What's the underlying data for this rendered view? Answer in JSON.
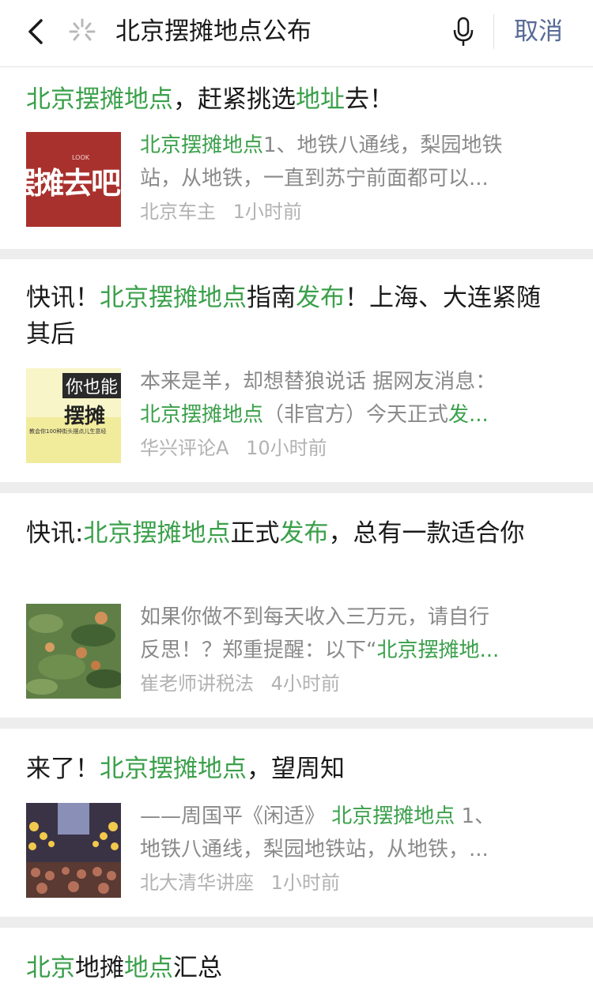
{
  "search": {
    "query": "北京摆摊地点公布",
    "cancel_label": "取消"
  },
  "results": [
    {
      "title": [
        {
          "text": "北京摆摊地点",
          "hl": true
        },
        {
          "text": "，赶紧挑选",
          "hl": false
        },
        {
          "text": "地址",
          "hl": true
        },
        {
          "text": "去！",
          "hl": false
        }
      ],
      "snippet_lines": [
        [
          {
            "text": "北京摆摊地点",
            "hl": true
          },
          {
            "text": "1、地铁八通线，梨园地铁",
            "hl": false
          }
        ],
        [
          {
            "text": "站，从地铁，一直到苏宁前面都可以...",
            "hl": false
          }
        ]
      ],
      "source": "北京车主",
      "time": "1小时前",
      "thumb_text": "摆摊去吧",
      "thumb_small_text": "LOOK"
    },
    {
      "title": [
        {
          "text": "快讯！",
          "hl": false
        },
        {
          "text": "北京摆摊地点",
          "hl": true
        },
        {
          "text": "指南",
          "hl": false
        },
        {
          "text": "发布",
          "hl": true
        },
        {
          "text": "！上海、大连紧随其后",
          "hl": false
        }
      ],
      "snippet_lines": [
        [
          {
            "text": "本来是羊，却想替狼说话 据网友消息：",
            "hl": false
          }
        ],
        [
          {
            "text": "北京摆摊地点",
            "hl": true
          },
          {
            "text": "（非官方）今天正式",
            "hl": false
          },
          {
            "text": "发...",
            "hl": true
          }
        ]
      ],
      "source": "华兴评论A",
      "time": "10小时前",
      "thumb_text_top": "你也能",
      "thumb_text_main": "摆摊",
      "thumb_small_text": "教会你100种街头摆点儿生意经"
    },
    {
      "title": [
        {
          "text": "快讯:",
          "hl": false
        },
        {
          "text": "北京摆摊地点",
          "hl": true
        },
        {
          "text": "正式",
          "hl": false
        },
        {
          "text": "发布",
          "hl": true
        },
        {
          "text": "，总有一款适合你",
          "hl": false
        }
      ],
      "snippet_lines": [
        [
          {
            "text": "如果你做不到每天收入三万元，请自行",
            "hl": false
          }
        ],
        [
          {
            "text": "反思！？郑重提醒：以下“",
            "hl": false
          },
          {
            "text": "北京摆摊地...",
            "hl": true
          }
        ]
      ],
      "source": "崔老师讲税法",
      "time": "4小时前"
    },
    {
      "title": [
        {
          "text": "来了！",
          "hl": false
        },
        {
          "text": "北京摆摊地点",
          "hl": true
        },
        {
          "text": "，望周知",
          "hl": false
        }
      ],
      "snippet_lines": [
        [
          {
            "text": "——周国平《闲适》 ",
            "hl": false
          },
          {
            "text": "北京摆摊地点",
            "hl": true
          },
          {
            "text": " 1、",
            "hl": false
          }
        ],
        [
          {
            "text": "地铁八通线，梨园地铁站，从地铁，...",
            "hl": false
          }
        ]
      ],
      "source": "北大清华讲座",
      "time": "1小时前"
    },
    {
      "title": [
        {
          "text": "北京",
          "hl": true
        },
        {
          "text": "地摊",
          "hl": false
        },
        {
          "text": "地点",
          "hl": true
        },
        {
          "text": "汇总",
          "hl": false
        }
      ]
    }
  ],
  "colors": {
    "highlight": "#3aa04a",
    "cancel": "#576b95",
    "meta": "#b2b2b2",
    "snippet": "#8a8a8a",
    "separator": "#ededed"
  }
}
